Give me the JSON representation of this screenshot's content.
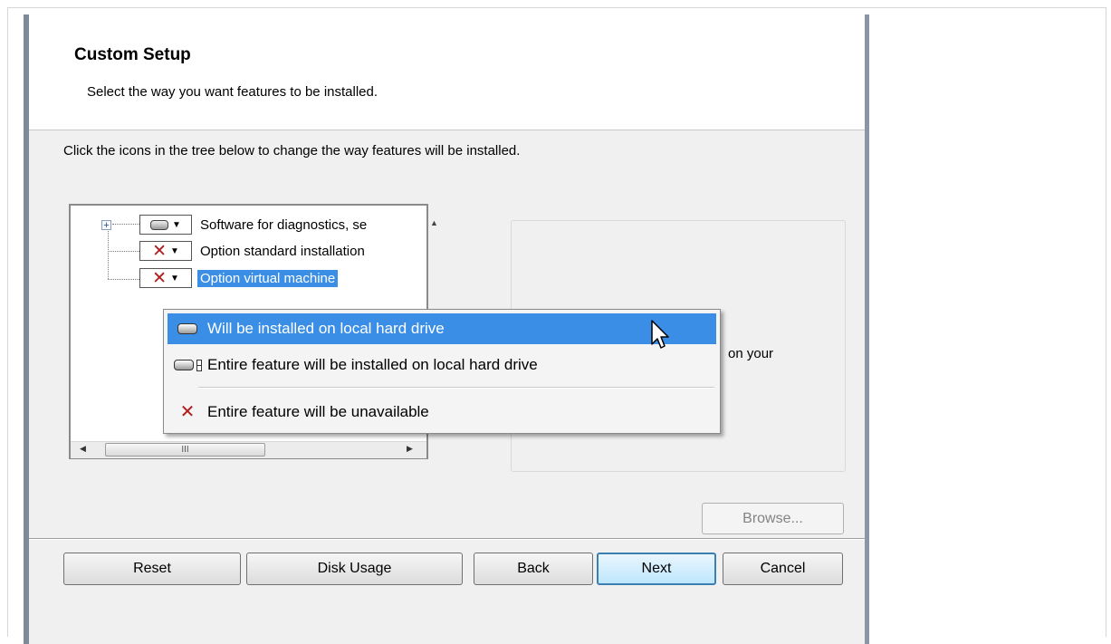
{
  "header": {
    "title": "Custom Setup",
    "subtitle": "Select the way you want features to be installed."
  },
  "instructions": "Click the icons in the tree below to change the way features will be installed.",
  "tree": {
    "items": [
      {
        "label": "Software for diagnostics, se",
        "icon": "hard-drive-icon"
      },
      {
        "label": "Option standard installation",
        "icon": "x-icon"
      },
      {
        "label": "Option virtual machine",
        "icon": "x-icon",
        "selected": true
      }
    ],
    "hscroll_grip": "III"
  },
  "context_menu": {
    "items": [
      {
        "label": "Will be installed on local hard drive",
        "icon": "hard-drive-icon",
        "highlighted": true
      },
      {
        "label": "Entire feature will be installed on local hard drive",
        "icon": "hard-drive-multi-icon"
      },
      {
        "label": "Entire feature will be unavailable",
        "icon": "x-icon"
      }
    ]
  },
  "description": {
    "partial_text": "on your"
  },
  "buttons": {
    "browse": "Browse...",
    "reset": "Reset",
    "disk_usage": "Disk Usage",
    "back": "Back",
    "next": "Next",
    "cancel": "Cancel"
  },
  "colors": {
    "selection": "#3a8ee6",
    "unavailable_x": "#b21c1c",
    "dialog_bg": "#f0f0f0"
  }
}
